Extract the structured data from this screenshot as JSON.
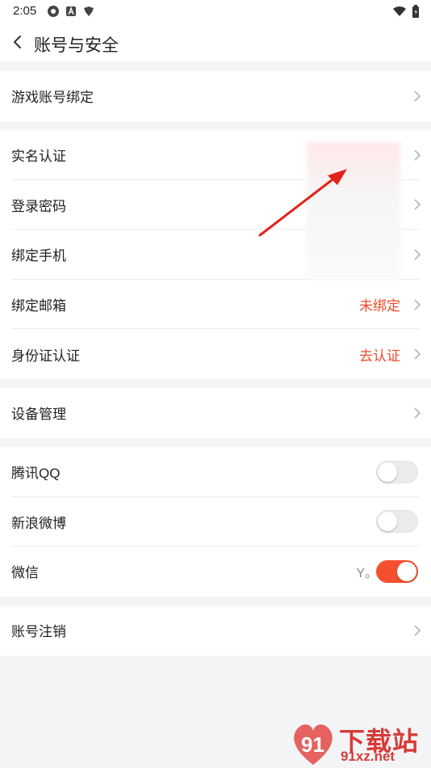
{
  "status_bar": {
    "time": "2:05",
    "left_icons": [
      "chrome-like-icon",
      "a-icon",
      "tieba-bird-icon"
    ],
    "right_icons": [
      "wifi-icon",
      "battery-icon"
    ]
  },
  "header": {
    "title": "账号与安全"
  },
  "groups": [
    {
      "rows": [
        {
          "label": "游戏账号绑定",
          "value": ""
        }
      ]
    },
    {
      "rows": [
        {
          "label": "实名认证",
          "value": ""
        },
        {
          "label": "登录密码",
          "value": ""
        },
        {
          "label": "绑定手机",
          "value": ""
        },
        {
          "label": "绑定邮箱",
          "value": "未绑定"
        },
        {
          "label": "身份证认证",
          "value": "去认证"
        }
      ]
    },
    {
      "rows": [
        {
          "label": "设备管理",
          "value": ""
        }
      ]
    },
    {
      "rows": [
        {
          "label": "腾讯QQ",
          "toggle": false,
          "value": ""
        },
        {
          "label": "新浪微博",
          "toggle": false,
          "value": ""
        },
        {
          "label": "微信",
          "toggle": true,
          "value": "Y。"
        }
      ]
    },
    {
      "rows": [
        {
          "label": "账号注销",
          "value": ""
        }
      ]
    }
  ],
  "colors": {
    "accent": "#f4502f",
    "value_red": "#ef4a2b",
    "arrow_red": "#e2231a"
  },
  "watermark": {
    "title": "下载站",
    "url": "91xz.net",
    "logo_text": "91"
  }
}
